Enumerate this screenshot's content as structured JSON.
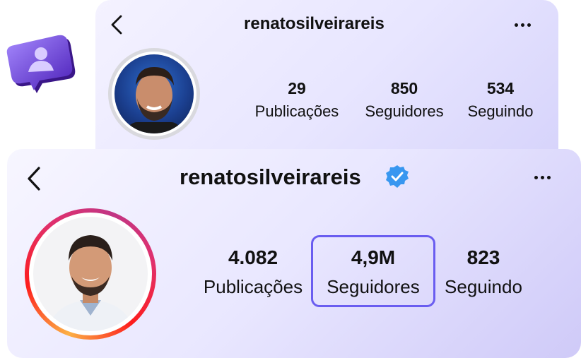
{
  "profile_old": {
    "username": "renatosilveirareis",
    "stats": [
      {
        "value": "29",
        "label": "Publicações"
      },
      {
        "value": "850",
        "label": "Seguidores"
      },
      {
        "value": "534",
        "label": "Seguindo"
      }
    ]
  },
  "profile_new": {
    "username": "renatosilveirareis",
    "verified": true,
    "stats": [
      {
        "value": "4.082",
        "label": "Publicações"
      },
      {
        "value": "4,9M",
        "label": "Seguidores"
      },
      {
        "value": "823",
        "label": "Seguindo"
      }
    ],
    "highlighted_stat": "Seguidores"
  },
  "icons": {
    "back": "chevron-left-icon",
    "more": "more-horizontal-icon",
    "verified": "verified-badge-icon",
    "followers": "user-notification-icon"
  },
  "colors": {
    "accent": "#6a5df0",
    "verified": "#3897f0",
    "story_ring": [
      "#fcb045",
      "#fd1d1d",
      "#e1306c",
      "#c13584"
    ]
  }
}
